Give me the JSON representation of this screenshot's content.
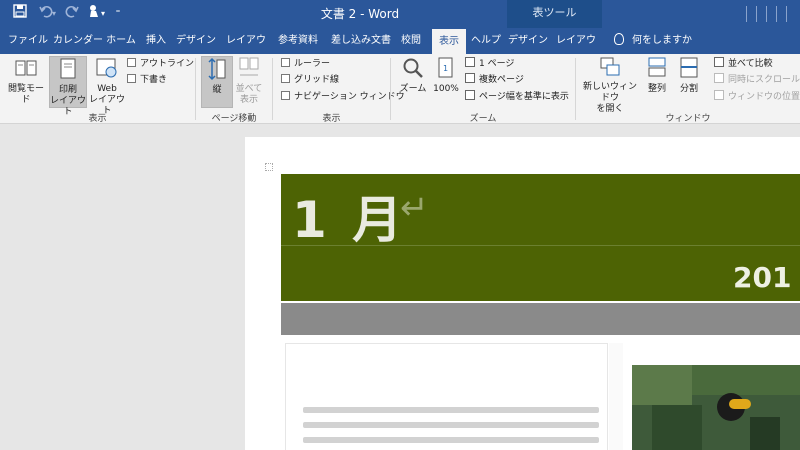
{
  "titlebar": {
    "doc_title": "文書 2 - Word",
    "tool_context": "表ツール",
    "qa_icons": [
      "save-icon",
      "undo-icon",
      "redo-icon",
      "touch-mode-icon",
      "customize-icon"
    ]
  },
  "tabs": [
    {
      "label": "ファイル"
    },
    {
      "label": "カレンダー"
    },
    {
      "label": "ホーム"
    },
    {
      "label": "挿入"
    },
    {
      "label": "デザイン"
    },
    {
      "label": "レイアウト"
    },
    {
      "label": "参考資料"
    },
    {
      "label": "差し込み文書"
    },
    {
      "label": "校閲"
    },
    {
      "label": "表示",
      "active": true
    },
    {
      "label": "ヘルプ"
    },
    {
      "label": "デザイン"
    },
    {
      "label": "レイアウト"
    }
  ],
  "tellme": {
    "label": "何をしますか"
  },
  "ribbon": {
    "views": {
      "group_label": "表示",
      "reading_mode": "閲覧モード",
      "print_layout": "印刷\nレイアウト",
      "web_layout": "Web\nレイアウト",
      "outline": "アウトライン",
      "draft": "下書き"
    },
    "page_move": {
      "group_label": "ページ移動",
      "vertical": "縦",
      "side_by_side": "並べて\n表示"
    },
    "show": {
      "group_label": "表示",
      "ruler": "ルーラー",
      "gridlines": "グリッド線",
      "nav_pane": "ナビゲーション ウィンドウ"
    },
    "zoom": {
      "group_label": "ズーム",
      "zoom": "ズーム",
      "hundred": "100%",
      "one_page": "1 ページ",
      "multi_page": "複数ページ",
      "page_width": "ページ幅を基準に表示"
    },
    "window": {
      "group_label": "ウィンドウ",
      "new_window": "新しいウィンドウ\nを開く",
      "arrange": "整列",
      "split": "分割",
      "side_compare": "並べて比較",
      "sync_scroll": "同時にスクロール",
      "reset_pos": "ウィンドウの位置を元"
    }
  },
  "document": {
    "month": "1 月",
    "paragraph_mark": "↵",
    "year": "201",
    "subbar_text": "",
    "column_heading": ""
  },
  "colors": {
    "title_blue": "#2b579a",
    "banner_green": "#4d6304",
    "subbar_gray": "#8a8a8a"
  }
}
